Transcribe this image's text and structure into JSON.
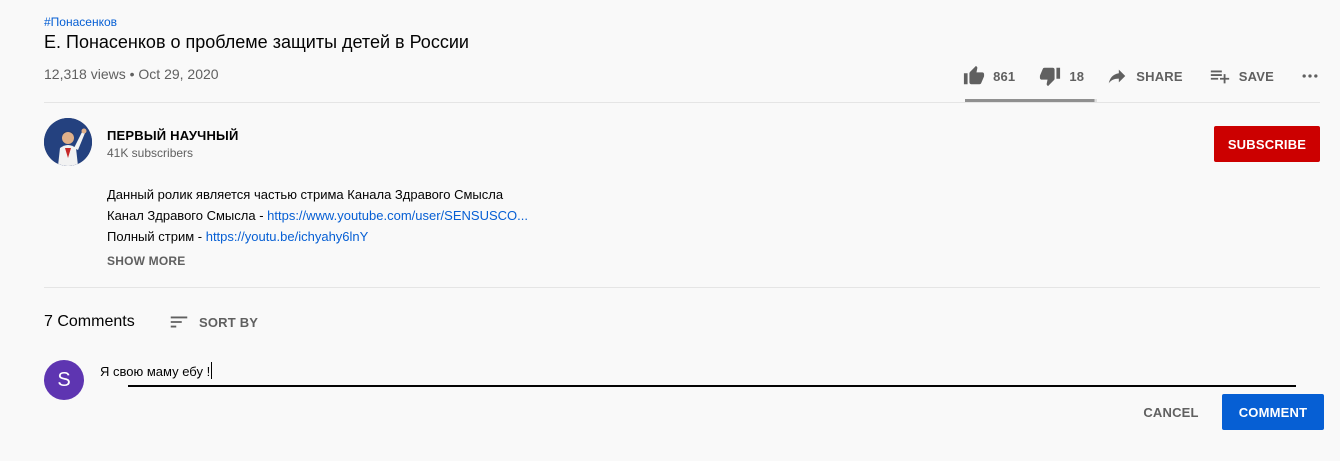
{
  "video": {
    "hashtag": "#Понасенков",
    "title": "Е. Понасенков о проблеме защиты детей в России",
    "meta": "12,318 views • Oct 29, 2020"
  },
  "actions": {
    "likes": "861",
    "dislikes": "18",
    "share_label": "SHARE",
    "save_label": "SAVE",
    "like_ratio": 0.98
  },
  "channel": {
    "name": "ПЕРВЫЙ НАУЧНЫЙ",
    "subscribers": "41K subscribers",
    "subscribe_label": "SUBSCRIBE",
    "subscribe_color": "#cc0000"
  },
  "description": {
    "line1": "Данный ролик является частью стрима Канала Здравого Смысла",
    "line2_text": "Канал Здравого Смысла - ",
    "line2_link": "https://www.youtube.com/user/SENSUSCO...",
    "line3_text": "Полный стрим - ",
    "line3_link": "https://youtu.be/ichyahy6lnY",
    "show_more": "SHOW MORE"
  },
  "comments": {
    "count_label": "7 Comments",
    "sort_label": "SORT BY",
    "user_initial": "S",
    "user_avatar_color": "#5e35b1",
    "input_value": "Я свою маму ебу !",
    "cancel_label": "CANCEL",
    "comment_label": "COMMENT",
    "comment_color": "#065fd4"
  },
  "icons": {
    "like": "thumb-up-icon",
    "dislike": "thumb-down-icon",
    "share": "share-arrow-icon",
    "save": "playlist-add-icon",
    "more": "more-horizontal-icon",
    "sort": "sort-lines-icon"
  }
}
